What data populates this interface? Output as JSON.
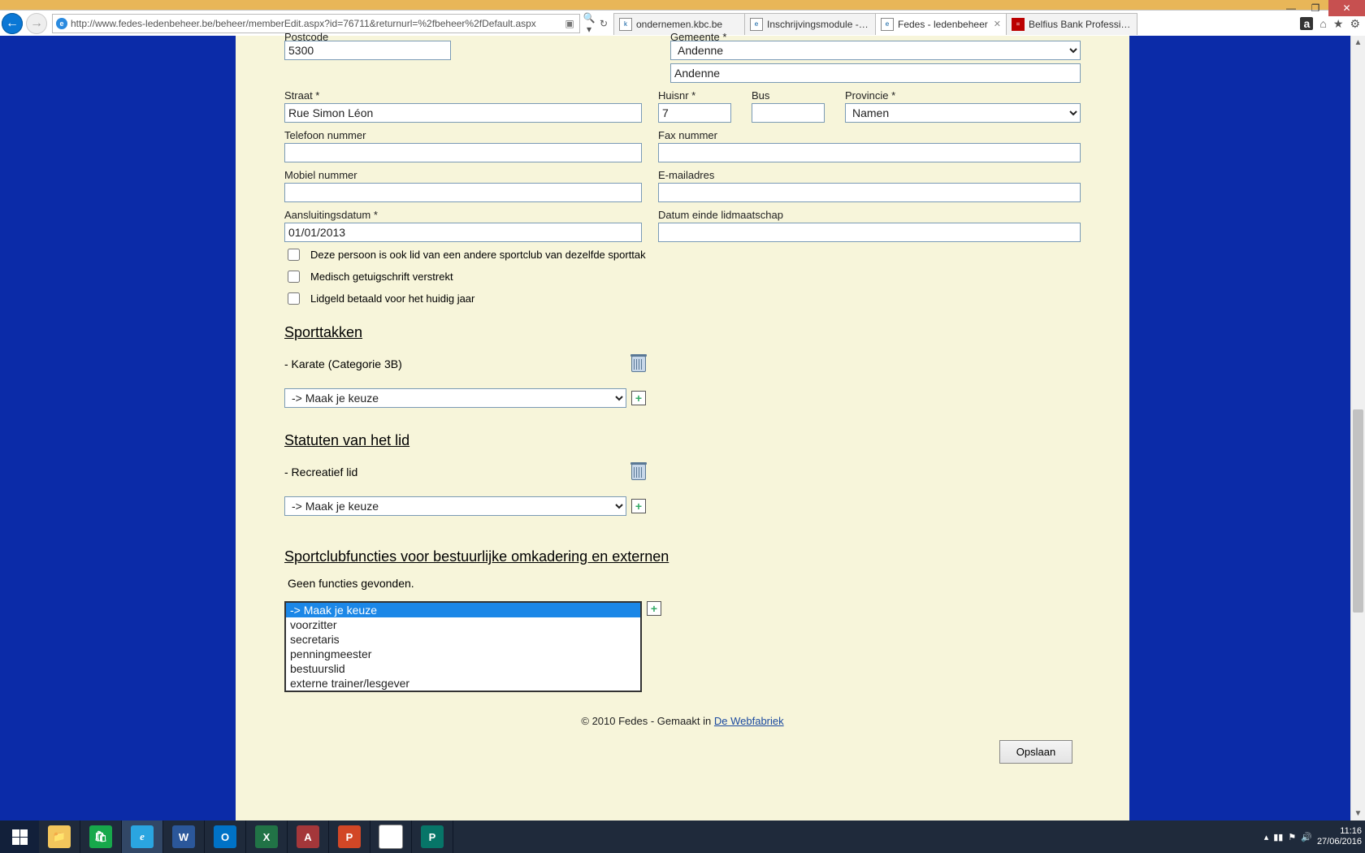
{
  "window": {
    "minimize": "—",
    "maximize": "❐",
    "close": "✕"
  },
  "browser": {
    "url": "http://www.fedes-ledenbeheer.be/beheer/memberEdit.aspx?id=76711&returnurl=%2fbeheer%2fDefault.aspx",
    "tabs": [
      {
        "label": "ondernemen.kbc.be"
      },
      {
        "label": "Inschrijvingsmodule - Insc..."
      },
      {
        "label": "Fedes - ledenbeheer",
        "active": true
      },
      {
        "label": "Belfius Bank Professioneel..."
      }
    ]
  },
  "form": {
    "postcode_label": "Postcode",
    "postcode": "5300",
    "gemeente_label": "Gemeente *",
    "gemeente_select": "Andenne",
    "gemeente_text": "Andenne",
    "straat_label": "Straat *",
    "straat": "Rue Simon Léon",
    "huisnr_label": "Huisnr *",
    "huisnr": "7",
    "bus_label": "Bus",
    "bus": "",
    "provincie_label": "Provincie *",
    "provincie": "Namen",
    "telefoon_label": "Telefoon nummer",
    "telefoon": "",
    "fax_label": "Fax nummer",
    "fax": "",
    "mobiel_label": "Mobiel nummer",
    "mobiel": "",
    "email_label": "E-mailadres",
    "email": "",
    "aansluit_label": "Aansluitingsdatum *",
    "aansluit": "01/01/2013",
    "einde_label": "Datum einde lidmaatschap",
    "einde": "",
    "cb1": "Deze persoon is ook lid van een andere sportclub van dezelfde sporttak",
    "cb2": "Medisch getuigschrift verstrekt",
    "cb3": "Lidgeld betaald voor het huidig jaar",
    "sporttakken_h": "Sporttakken",
    "sporttak_item": "- Karate (Categorie 3B)",
    "keuze": "-> Maak je keuze",
    "statuten_h": "Statuten van het lid",
    "statuut_item": "- Recreatief lid",
    "functies_h": "Sportclubfuncties voor bestuurlijke omkadering en externen",
    "functies_empty": "Geen functies gevonden.",
    "functies_options": [
      "-> Maak je keuze",
      "voorzitter",
      "secretaris",
      "penningmeester",
      "bestuurslid",
      "externe trainer/lesgever"
    ],
    "save": "Opslaan"
  },
  "footer": {
    "prefix": "© 2010 Fedes - Gemaakt in ",
    "link": "De Webfabriek"
  },
  "taskbar": {
    "time": "11:16",
    "date": "27/06/2016"
  }
}
